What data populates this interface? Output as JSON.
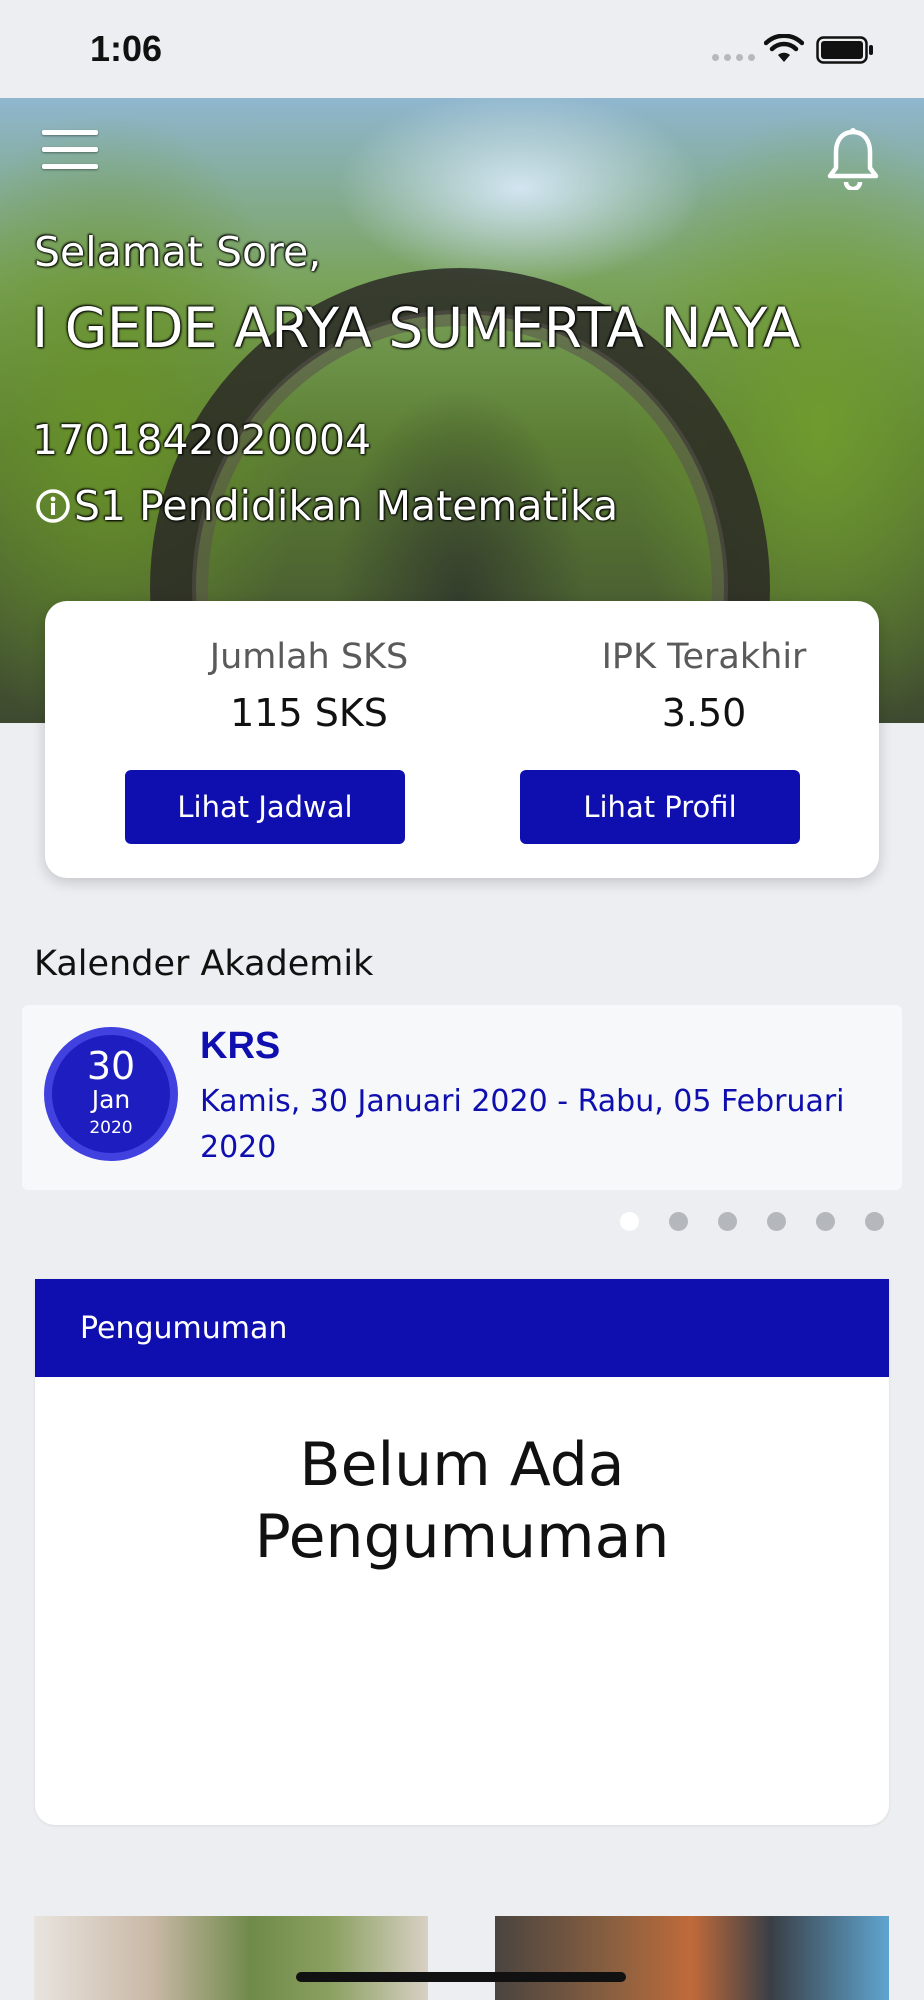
{
  "status_bar": {
    "time": "1:06"
  },
  "header": {
    "greeting": "Selamat Sore,",
    "name": "I GEDE ARYA SUMERTA NAYA",
    "nim": "1701842020004",
    "program": "S1 Pendidikan Matematika"
  },
  "stats": {
    "sks_label": "Jumlah SKS",
    "sks_value": "115 SKS",
    "ipk_label": "IPK Terakhir",
    "ipk_value": "3.50",
    "schedule_button": "Lihat Jadwal",
    "profile_button": "Lihat Profil"
  },
  "calendar": {
    "title": "Kalender Akademik",
    "event": {
      "day": "30",
      "month": "Jan",
      "year": "2020",
      "name": "KRS",
      "range": "Kamis, 30 Januari 2020 - Rabu, 05 Februari 2020"
    },
    "page_count": 6,
    "active_page": 1
  },
  "announcements": {
    "title": "Pengumuman",
    "empty_text": "Belum Ada Pengumuman"
  },
  "colors": {
    "accent": "#0f0fb0",
    "date_circle": "#1d1dc0",
    "background": "#eceef1"
  }
}
